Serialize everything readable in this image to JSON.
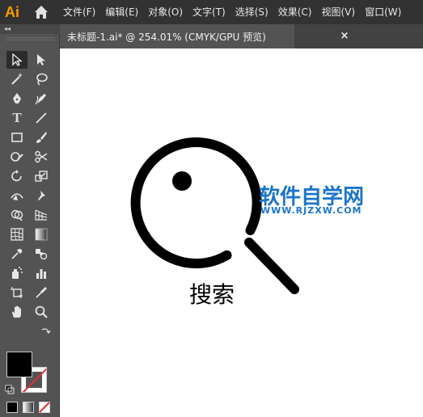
{
  "app": {
    "logo": "Ai",
    "home_icon": "home-icon"
  },
  "menu": [
    "文件(F)",
    "编辑(E)",
    "对象(O)",
    "文字(T)",
    "选择(S)",
    "效果(C)",
    "视图(V)",
    "窗口(W)"
  ],
  "document": {
    "tab_title": "未标题-1.ai* @ 254.01% (CMYK/GPU 预览)",
    "close_label": "×"
  },
  "toolbar": {
    "collapse_label": "◂◂",
    "tools": [
      {
        "icon": "selection-tool-icon",
        "active": true
      },
      {
        "icon": "direct-selection-tool-icon"
      },
      {
        "icon": "magic-wand-tool-icon"
      },
      {
        "icon": "lasso-tool-icon"
      },
      {
        "icon": "pen-tool-icon"
      },
      {
        "icon": "curvature-tool-icon"
      },
      {
        "icon": "type-tool-icon",
        "text": "T"
      },
      {
        "icon": "line-segment-tool-icon"
      },
      {
        "icon": "rectangle-tool-icon"
      },
      {
        "icon": "paintbrush-tool-icon"
      },
      {
        "icon": "shaper-tool-icon"
      },
      {
        "icon": "scissors-tool-icon"
      },
      {
        "icon": "rotate-tool-icon"
      },
      {
        "icon": "scale-tool-icon"
      },
      {
        "icon": "width-tool-icon"
      },
      {
        "icon": "puppet-warp-tool-icon"
      },
      {
        "icon": "shape-builder-tool-icon"
      },
      {
        "icon": "perspective-grid-tool-icon"
      },
      {
        "icon": "mesh-tool-icon"
      },
      {
        "icon": "gradient-tool-icon"
      },
      {
        "icon": "eyedropper-tool-icon"
      },
      {
        "icon": "blend-tool-icon"
      },
      {
        "icon": "symbol-sprayer-tool-icon"
      },
      {
        "icon": "column-graph-tool-icon"
      },
      {
        "icon": "artboard-tool-icon"
      },
      {
        "icon": "slice-tool-icon"
      },
      {
        "icon": "hand-tool-icon"
      },
      {
        "icon": "zoom-tool-icon"
      }
    ],
    "fill_color": "#000000",
    "stroke_color": "none"
  },
  "artwork": {
    "caption": "搜索",
    "stroke_color": "#000000"
  },
  "watermark": {
    "title": "软件自学网",
    "url": "WWW.RJZXW.COM",
    "color": "#1b75c9"
  }
}
